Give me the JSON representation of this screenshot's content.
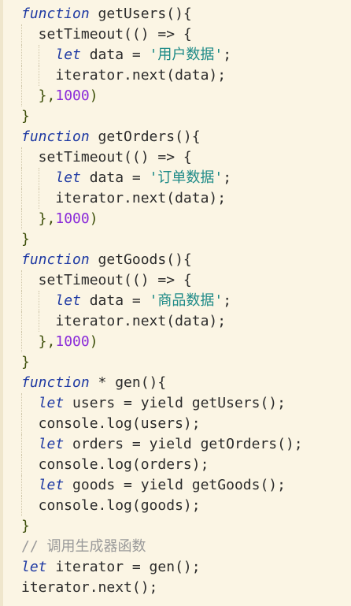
{
  "editor": {
    "lines": [
      [
        {
          "t": "function",
          "c": "kw"
        },
        {
          "t": " getUsers(){",
          "c": "fn"
        }
      ],
      [
        {
          "t": "  setTimeout(() => {",
          "c": "fn"
        }
      ],
      [
        {
          "t": "    ",
          "c": "fn"
        },
        {
          "t": "let",
          "c": "kw"
        },
        {
          "t": " data = ",
          "c": "fn"
        },
        {
          "t": "'用户数据'",
          "c": "str"
        },
        {
          "t": ";",
          "c": "fn"
        }
      ],
      [
        {
          "t": "    iterator.next(data);",
          "c": "fn"
        }
      ],
      [
        {
          "t": "  },",
          "c": "br"
        },
        {
          "t": "1000",
          "c": "num"
        },
        {
          "t": ")",
          "c": "br"
        }
      ],
      [
        {
          "t": "}",
          "c": "br"
        }
      ],
      [
        {
          "t": "function",
          "c": "kw"
        },
        {
          "t": " getOrders(){",
          "c": "fn"
        }
      ],
      [
        {
          "t": "  setTimeout(() => {",
          "c": "fn"
        }
      ],
      [
        {
          "t": "    ",
          "c": "fn"
        },
        {
          "t": "let",
          "c": "kw"
        },
        {
          "t": " data = ",
          "c": "fn"
        },
        {
          "t": "'订单数据'",
          "c": "str"
        },
        {
          "t": ";",
          "c": "fn"
        }
      ],
      [
        {
          "t": "    iterator.next(data);",
          "c": "fn"
        }
      ],
      [
        {
          "t": "  },",
          "c": "br"
        },
        {
          "t": "1000",
          "c": "num"
        },
        {
          "t": ")",
          "c": "br"
        }
      ],
      [
        {
          "t": "}",
          "c": "br"
        }
      ],
      [
        {
          "t": "function",
          "c": "kw"
        },
        {
          "t": " getGoods(){",
          "c": "fn"
        }
      ],
      [
        {
          "t": "  setTimeout(() => {",
          "c": "fn"
        }
      ],
      [
        {
          "t": "    ",
          "c": "fn"
        },
        {
          "t": "let",
          "c": "kw"
        },
        {
          "t": " data = ",
          "c": "fn"
        },
        {
          "t": "'商品数据'",
          "c": "str"
        },
        {
          "t": ";",
          "c": "fn"
        }
      ],
      [
        {
          "t": "    iterator.next(data);",
          "c": "fn"
        }
      ],
      [
        {
          "t": "  },",
          "c": "br"
        },
        {
          "t": "1000",
          "c": "num"
        },
        {
          "t": ")",
          "c": "br"
        }
      ],
      [
        {
          "t": "}",
          "c": "br"
        }
      ],
      [
        {
          "t": "function",
          "c": "kw"
        },
        {
          "t": " * gen(){",
          "c": "fn"
        }
      ],
      [
        {
          "t": "  ",
          "c": "fn"
        },
        {
          "t": "let",
          "c": "kw"
        },
        {
          "t": " users = yield getUsers();",
          "c": "fn"
        }
      ],
      [
        {
          "t": "  console.log(users);",
          "c": "fn"
        }
      ],
      [
        {
          "t": "  ",
          "c": "fn"
        },
        {
          "t": "let",
          "c": "kw"
        },
        {
          "t": " orders = yield getOrders();",
          "c": "fn"
        }
      ],
      [
        {
          "t": "  console.log(orders);",
          "c": "fn"
        }
      ],
      [
        {
          "t": "  ",
          "c": "fn"
        },
        {
          "t": "let",
          "c": "kw"
        },
        {
          "t": " goods = yield getGoods();",
          "c": "fn"
        }
      ],
      [
        {
          "t": "  console.log(goods);",
          "c": "fn"
        }
      ],
      [
        {
          "t": "}",
          "c": "br"
        }
      ],
      [
        {
          "t": "// 调用生成器函数",
          "c": "cm"
        }
      ],
      [
        {
          "t": "let",
          "c": "kw"
        },
        {
          "t": " iterator = gen();",
          "c": "fn"
        }
      ],
      [
        {
          "t": "iterator.next();",
          "c": "fn"
        }
      ]
    ],
    "indent_guides": [
      [],
      [
        1
      ],
      [
        1,
        2
      ],
      [
        1,
        2
      ],
      [
        1
      ],
      [],
      [],
      [
        1
      ],
      [
        1,
        2
      ],
      [
        1,
        2
      ],
      [
        1
      ],
      [],
      [],
      [
        1
      ],
      [
        1,
        2
      ],
      [
        1,
        2
      ],
      [
        1
      ],
      [],
      [],
      [
        1
      ],
      [
        1
      ],
      [
        1
      ],
      [
        1
      ],
      [
        1
      ],
      [
        1
      ],
      [],
      [],
      [],
      []
    ]
  }
}
